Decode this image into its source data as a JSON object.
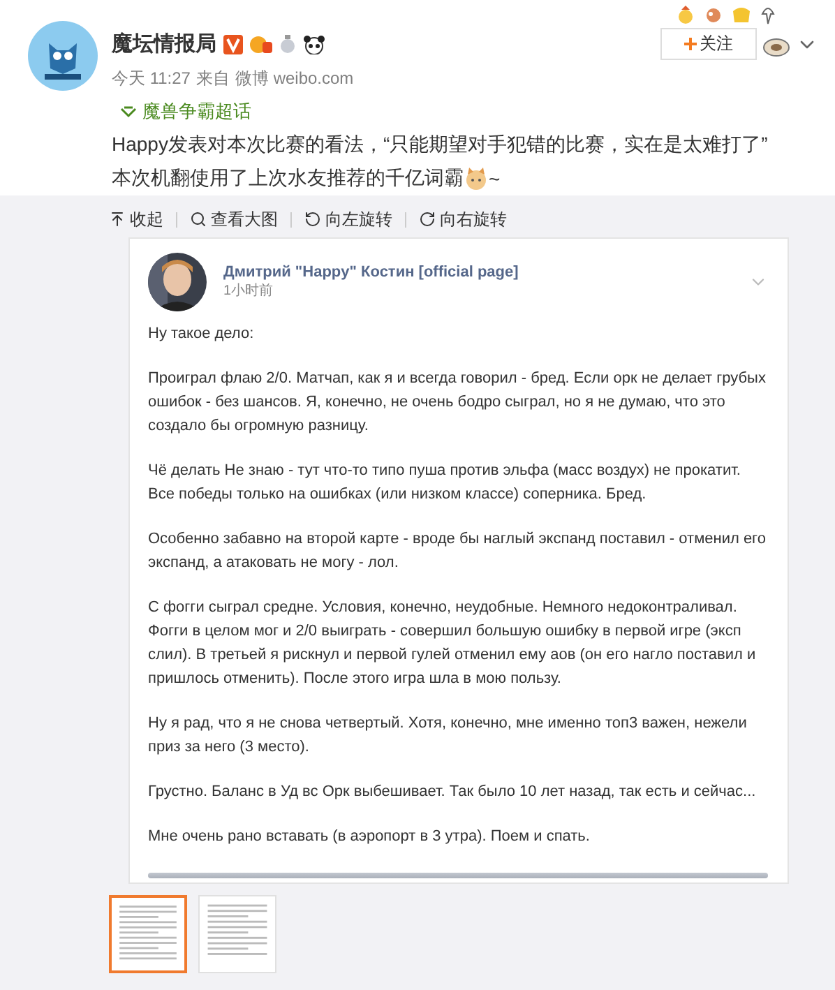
{
  "account": {
    "name": "魔坛情报局",
    "time": "今天 11:27",
    "source_prefix": "来自",
    "source": "微博 weibo.com"
  },
  "follow_button": {
    "label": "关注"
  },
  "topic": {
    "label": "魔兽争霸超话"
  },
  "post": {
    "line_1": "Happy发表对本次比赛的看法，“只能期望对手犯错的比赛，实在是太难打了”",
    "line_2": "本次机翻使用了上次水友推荐的千亿词霸",
    "line_2_tail": "~"
  },
  "toolbar": [
    {
      "kind": "collapse",
      "label": "收起"
    },
    {
      "kind": "zoom",
      "label": "查看大图"
    },
    {
      "kind": "rotate_left",
      "label": "向左旋转"
    },
    {
      "kind": "rotate_right",
      "label": "向右旋转"
    }
  ],
  "image": {
    "author": "Дмитрий \"Happy\" Костин [official page]",
    "time": "1小时前",
    "paragraphs": [
      "Ну такое дело:",
      "Проиграл флаю 2/0. Матчап, как я и всегда говорил - бред. Если орк не делает грубых ошибок - без шансов. Я, конечно, не очень бодро сыграл, но я не думаю, что это создало бы огромную разницу.",
      "Чё делать Не знаю - тут что-то типо пуша против эльфа (масс воздух) не прокатит. Все победы только на ошибках (или низком классе) соперника. Бред.",
      "Особенно забавно на второй карте - вроде бы наглый экспанд поставил - отменил его экспанд, а атаковать не могу - лол.",
      "С фогги сыграл средне. Условия, конечно, неудобные. Немного недоконтраливал. Фогги в целом мог и 2/0 выиграть - совершил большую ошибку в первой игре (эксп слил). В третьей я рискнул и первой гулей отменил ему аов (он его нагло поставил и пришлось отменить). После этого игра шла в мою пользу.",
      "Ну я рад, что я не снова четвертый. Хотя, конечно, мне именно топ3 важен, нежели приз за него (3 место).",
      "Грустно. Баланс в Уд вс Орк выбешивает. Так было 10 лет назад, так есть и сейчас...",
      "Мне очень рано вставать (в аэропорт в 3 утра). Поем и спать."
    ]
  },
  "thumbnails": [
    {
      "selected": true
    },
    {
      "selected": false
    }
  ]
}
